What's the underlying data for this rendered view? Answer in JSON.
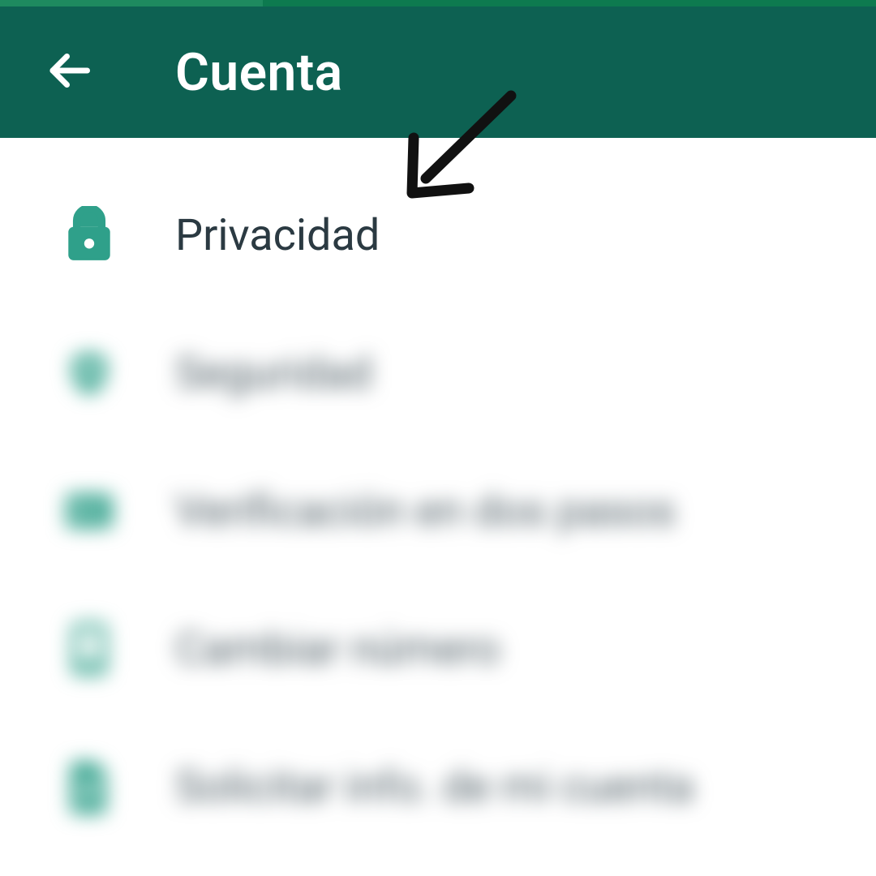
{
  "header": {
    "title": "Cuenta"
  },
  "items": [
    {
      "label": "Privacidad",
      "icon": "lock-icon",
      "blurred": false
    },
    {
      "label": "Seguridad",
      "icon": "shield-icon",
      "blurred": true
    },
    {
      "label": "Verificación en dos pasos",
      "icon": "badge-icon",
      "blurred": true
    },
    {
      "label": "Cambiar número",
      "icon": "phone-icon",
      "blurred": true
    },
    {
      "label": "Solicitar info. de mi cuenta",
      "icon": "document-icon",
      "blurred": true
    }
  ],
  "colors": {
    "primary": "#0d6152",
    "accent": "#2fa08a"
  }
}
